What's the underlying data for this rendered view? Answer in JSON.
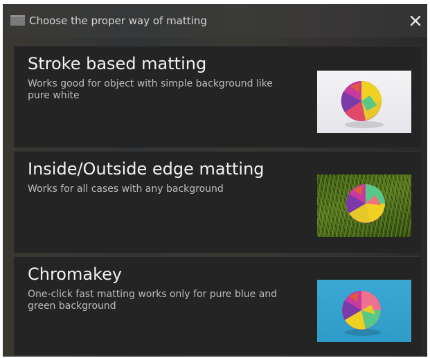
{
  "dialog": {
    "title": "Choose the proper way of matting",
    "close_glyph": "✕"
  },
  "options": [
    {
      "title": "Stroke based matting",
      "description": "Works good for object with simple background like pure white",
      "thumbnail_background": "#ececf0"
    },
    {
      "title": "Inside/Outside edge matting",
      "description": "Works for all cases with any background",
      "thumbnail_background": "#4a6a1a"
    },
    {
      "title": "Chromakey",
      "description": "One-click fast matting works only for pure blue and green background",
      "thumbnail_background": "#34a2d0"
    }
  ],
  "colors": {
    "panel": "#242424",
    "title_text": "#f2f2f2",
    "body_text": "#bdbdbd"
  }
}
